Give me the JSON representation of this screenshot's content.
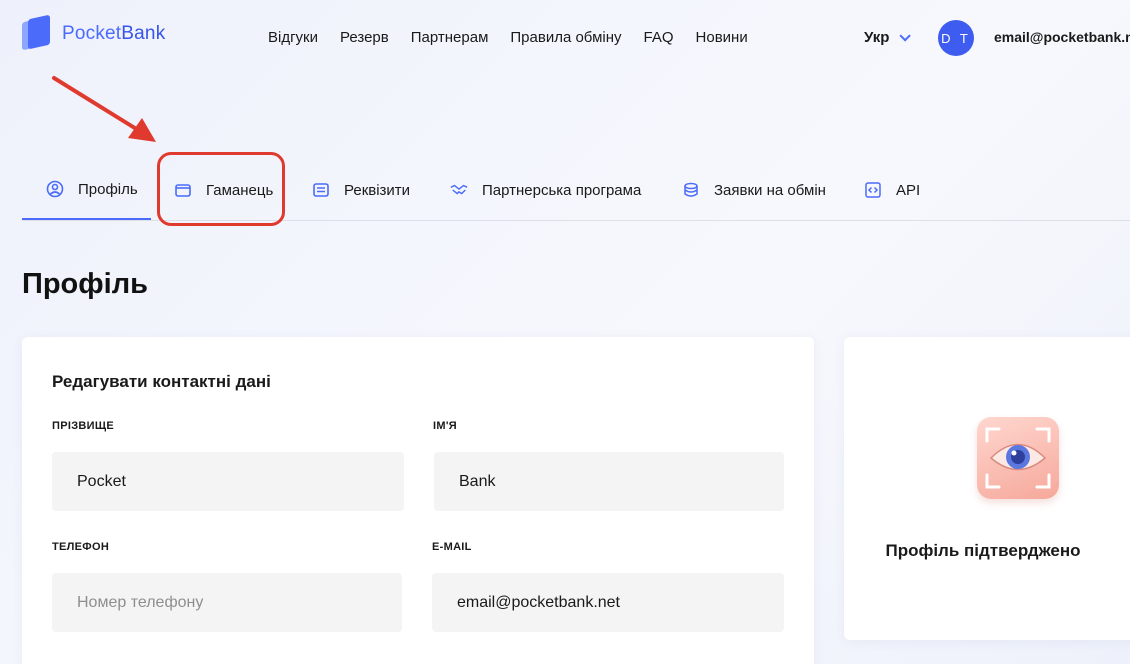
{
  "brand": {
    "name_part1": "Pocket",
    "name_part2": "Bank"
  },
  "top_nav": [
    {
      "label": "Відгуки"
    },
    {
      "label": "Резерв"
    },
    {
      "label": "Партнерам"
    },
    {
      "label": "Правила обміну"
    },
    {
      "label": "FAQ"
    },
    {
      "label": "Новини"
    }
  ],
  "header": {
    "language": "Укр",
    "avatar_initials": "D T",
    "user_email": "email@pocketbank.net"
  },
  "tabs": [
    {
      "label": "Профіль",
      "icon": "user-circle-icon",
      "active": true
    },
    {
      "label": "Гаманець",
      "icon": "wallet-icon",
      "active": false
    },
    {
      "label": "Реквізити",
      "icon": "card-details-icon",
      "active": false
    },
    {
      "label": "Партнерська програма",
      "icon": "handshake-icon",
      "active": false
    },
    {
      "label": "Заявки на обмін",
      "icon": "coins-icon",
      "active": false
    },
    {
      "label": "API",
      "icon": "code-icon",
      "active": false
    }
  ],
  "page_title": "Профіль",
  "contact_form": {
    "title": "Редагувати контактні дані",
    "last_name": {
      "label": "Прізвище",
      "value": "Pocket"
    },
    "first_name": {
      "label": "Ім'я",
      "value": "Bank"
    },
    "phone": {
      "label": "Телефон",
      "value": "",
      "placeholder": "Номер телефону"
    },
    "email": {
      "label": "E-mail",
      "value": "email@pocketbank.net"
    }
  },
  "verification": {
    "status_text": "Профіль підтверджено"
  },
  "colors": {
    "accent": "#4b6bfb",
    "annotation": "#e0392e"
  }
}
